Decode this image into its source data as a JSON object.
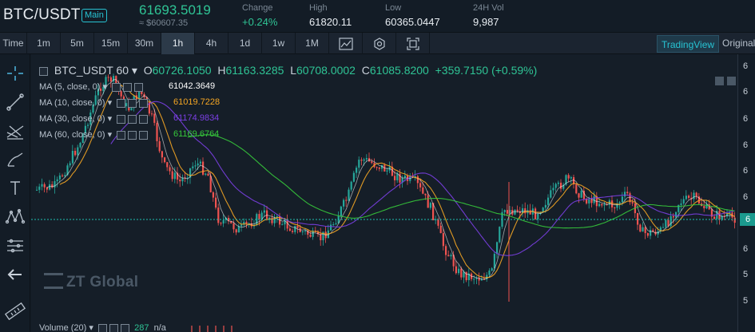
{
  "ticker": {
    "pair": "BTC/USDT",
    "badge": "Main",
    "last_price": "61693.5019",
    "approx": "≈ $60607.35",
    "stats": [
      {
        "label": "Change",
        "value": "+0.24%",
        "up": true
      },
      {
        "label": "High",
        "value": "61820.11",
        "up": false
      },
      {
        "label": "Low",
        "value": "60365.0447",
        "up": false
      },
      {
        "label": "24H Vol",
        "value": "9,987",
        "up": false
      }
    ]
  },
  "toolbar": {
    "intervals": [
      "Time",
      "1m",
      "5m",
      "15m",
      "30m",
      "1h",
      "4h",
      "1d",
      "1w",
      "1M"
    ],
    "active": "1h",
    "tradingview": "TradingView",
    "original": "Original"
  },
  "legend": {
    "symbol": "BTC_USDT",
    "interval": "60",
    "o_label": "O",
    "o": "60726.1050",
    "h_label": "H",
    "h": "61163.3285",
    "l_label": "L",
    "l": "60708.0002",
    "c_label": "C",
    "c": "61085.8200",
    "change": "+359.7150 (+0.59%)",
    "mas": [
      {
        "label": "MA (5, close, 0)",
        "value": "61042.3649",
        "color": "#ffffff"
      },
      {
        "label": "MA (10, close, 0)",
        "value": "61019.7228",
        "color": "#f5a623"
      },
      {
        "label": "MA (30, close, 0)",
        "value": "61174.9834",
        "color": "#7b3fe4"
      },
      {
        "label": "MA (60, close, 0)",
        "value": "61169.6764",
        "color": "#36c93b"
      }
    ],
    "volume_label": "Volume (20)",
    "volume_value": "287",
    "volume_na": "n/a"
  },
  "watermark": "ZT Global",
  "price_axis": {
    "ticks": [
      "6",
      "6",
      "6",
      "6",
      "6",
      "6",
      "6",
      "6",
      "5",
      "5"
    ],
    "current": "6"
  },
  "colors": {
    "up": "#26a69a",
    "down": "#ef5350",
    "accent": "#27c3d3",
    "ma5": "#ffffff",
    "ma10": "#f5a623",
    "ma30": "#7b3fe4",
    "ma60": "#36c93b"
  },
  "tools": [
    "crosshair-icon",
    "trendline-icon",
    "fib-icon",
    "brush-icon",
    "text-icon",
    "pattern-icon",
    "measure-icon",
    "back-arrow-icon",
    "ruler-icon"
  ]
}
